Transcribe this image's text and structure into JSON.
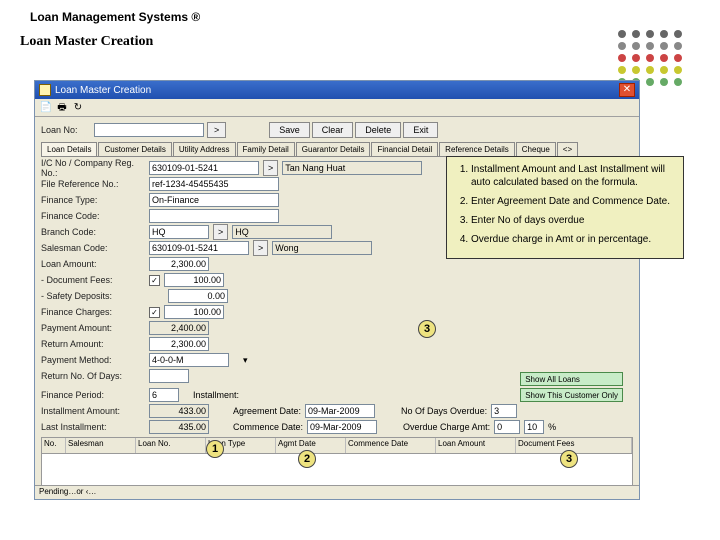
{
  "header": {
    "brand": "Loan Management Systems ®",
    "page": "Loan Master Creation"
  },
  "window": {
    "title": "Loan Master Creation"
  },
  "top": {
    "loan_no_label": "Loan No:",
    "loan_no": "",
    "go": ">",
    "buttons": {
      "save": "Save",
      "clear": "Clear",
      "delete": "Delete",
      "exit": "Exit"
    }
  },
  "tabs": [
    "Loan Details",
    "Customer Details",
    "Utility Address",
    "Family Detail",
    "Guarantor Details",
    "Financial Detail",
    "Reference Details",
    "Cheque",
    "<>"
  ],
  "fields": {
    "icno_l": "I/C No / Company Reg. No.:",
    "icno": "630109-01-5241",
    "name_l": "",
    "name": "Tan Nang Huat",
    "fileref_l": "File Reference No.:",
    "fileref": "ref-1234-45455435",
    "fintype_l": "Finance Type:",
    "fintype": "On-Finance",
    "fincode_l": "Finance Code:",
    "branch_l": "Branch Code:",
    "branch": "HQ",
    "branch_d": "HQ",
    "salesman_l": "Salesman Code:",
    "salesman": "630109-01-5241",
    "salesman_d": "Wong",
    "loanamt_l": "Loan Amount:",
    "loanamt": "2,300.00",
    "docfee_l": "- Document Fees:",
    "docfee_chk": "✓",
    "docfee": "100.00",
    "safety_l": "- Safety Deposits:",
    "safety": "0.00",
    "fincharge_l": "Finance Charges:",
    "fincharge_chk": "✓",
    "fincharge": "100.00",
    "payamt_l": "Payment Amount:",
    "payamt": "2,400.00",
    "return_l": "Return Amount:",
    "return": "2,300.00",
    "method_l": "Payment Method:",
    "method": "4-0-0-M",
    "rtn_days_l": "Return No. Of Days:",
    "finperiod_l": "Finance Period:",
    "finperiod": "6",
    "installno_l": "Installment:",
    "install_l": "Installment Amount:",
    "install": "433.00",
    "last_l": "Last Installment:",
    "last": "435.00",
    "agdate_l": "Agreement Date:",
    "agdate": "09-Mar-2009",
    "comdate_l": "Commence Date:",
    "comdate": "09-Mar-2009",
    "overdays_l": "No Of Days Overdue:",
    "overdays": "3",
    "overamt_l": "Overdue Charge Amt:",
    "overamt": "0",
    "overpct": "10",
    "pct": "%",
    "show_all": "Show All Loans",
    "show_cust": "Show This Customer Only"
  },
  "grid": [
    "No.",
    "Salesman",
    "Loan No.",
    "Loan Type",
    "Agmt Date",
    "Commence Date",
    "Loan Amount",
    "Document Fees"
  ],
  "status": "Pending…or ‹…",
  "notes": {
    "n1": "Installment Amount and Last Installment will auto calculated based on the formula.",
    "n2": "Enter Agreement Date and Commence Date.",
    "n3": "Enter No of days overdue",
    "n4": "Overdue charge in Amt or in percentage."
  },
  "badges": {
    "b1": "1",
    "b2": "2",
    "b3": "3",
    "b3b": "3"
  }
}
